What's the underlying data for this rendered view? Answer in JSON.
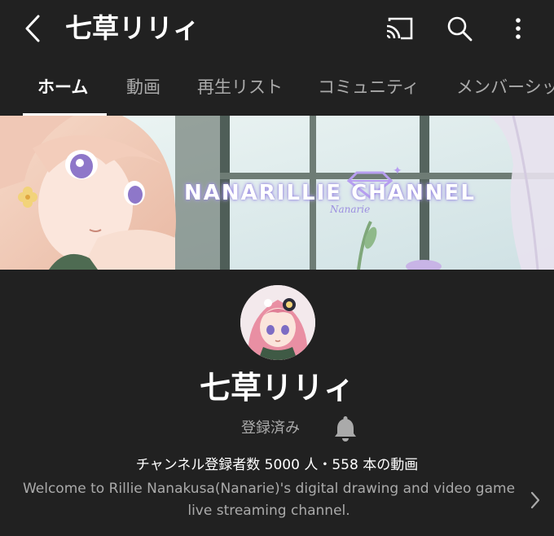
{
  "header": {
    "title": "七草リリィ",
    "icons": {
      "back": "chevron-left-icon",
      "cast": "cast-icon",
      "search": "search-icon",
      "more": "more-vertical-icon"
    }
  },
  "tabs": [
    {
      "label": "ホーム",
      "active": true
    },
    {
      "label": "動画",
      "active": false
    },
    {
      "label": "再生リスト",
      "active": false
    },
    {
      "label": "コミュニティ",
      "active": false
    },
    {
      "label": "メンバーシップ",
      "active": false
    }
  ],
  "banner": {
    "title": "NANARILLIE CHANNEL",
    "subtitle": "Nanarie"
  },
  "channel": {
    "name": "七草リリィ",
    "subscribed_label": "登録済み",
    "stats": "チャンネル登録者数 5000 人・558 本の動画",
    "description": "Welcome to Rillie Nanakusa(Nanarie)'s digital drawing and video game live streaming channel."
  },
  "colors": {
    "background": "#212121",
    "text_primary": "#ffffff",
    "text_secondary": "#aaaaaa"
  }
}
